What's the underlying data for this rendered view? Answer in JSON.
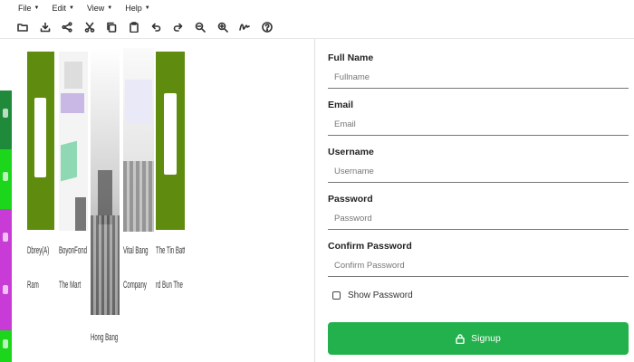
{
  "menubar": {
    "items": [
      {
        "label": "File"
      },
      {
        "label": "Edit"
      },
      {
        "label": "View"
      },
      {
        "label": "Help"
      }
    ]
  },
  "toolbar": {
    "icons": [
      "open-folder-icon",
      "download-icon",
      "share-icon",
      "cut-icon",
      "copy-icon",
      "paste-icon",
      "undo-icon",
      "redo-icon",
      "zoom-out-icon",
      "zoom-in-icon",
      "signature-icon",
      "help-icon"
    ]
  },
  "colors": {
    "accent": "#22b14c",
    "olive": "#5f8c0f",
    "strip_green": "#1f8b3a",
    "strip_lime": "#1cd61c",
    "strip_magenta": "#c93bd6"
  },
  "gallery": {
    "covers": [
      {
        "title": "Dbrey(A)",
        "subtitle": "Ram"
      },
      {
        "title": "BoyonFond",
        "subtitle": "The Mart"
      },
      {
        "title": "Hong Bang",
        "subtitle": ""
      },
      {
        "title": "Vital Bang",
        "subtitle": "Company"
      },
      {
        "title": "The Tin Batte",
        "subtitle": "rd Bun The"
      }
    ]
  },
  "form": {
    "fullname": {
      "label": "Full Name",
      "placeholder": "Fullname"
    },
    "email": {
      "label": "Email",
      "placeholder": "Email"
    },
    "username": {
      "label": "Username",
      "placeholder": "Username"
    },
    "password": {
      "label": "Password",
      "placeholder": "Password"
    },
    "confirm": {
      "label": "Confirm Password",
      "placeholder": "Confirm Password"
    },
    "show_password_label": "Show Password",
    "signup_label": "Signup"
  }
}
